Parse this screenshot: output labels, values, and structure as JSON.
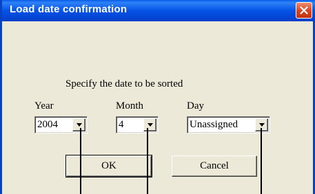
{
  "dialog": {
    "title": "Load date confirmation",
    "prompt": "Specify the date to be sorted"
  },
  "fields": {
    "year": {
      "label": "Year",
      "value": "2004"
    },
    "month": {
      "label": "Month",
      "value": "4"
    },
    "day": {
      "label": "Day",
      "value": "Unassigned"
    }
  },
  "buttons": {
    "ok": "OK",
    "cancel": "Cancel"
  },
  "icons": {
    "close": "close-icon",
    "dropdown": "chevron-down-icon"
  },
  "colors": {
    "titlebar": "#0553e6",
    "dialog_bg": "#ece9d8",
    "close_button": "#d8431e"
  }
}
